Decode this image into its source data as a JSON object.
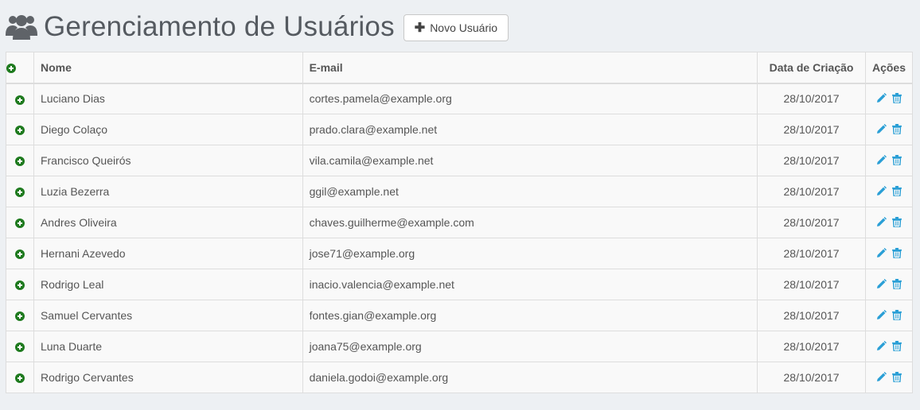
{
  "header": {
    "title": "Gerenciamento de Usuários",
    "new_button_label": "Novo Usuário",
    "icon": "users-icon"
  },
  "table": {
    "columns": {
      "name": "Nome",
      "email": "E-mail",
      "created": "Data de Criação",
      "actions": "Ações"
    },
    "rows": [
      {
        "name": "Luciano Dias",
        "email": "cortes.pamela@example.org",
        "created": "28/10/2017"
      },
      {
        "name": "Diego Colaço",
        "email": "prado.clara@example.net",
        "created": "28/10/2017"
      },
      {
        "name": "Francisco Queirós",
        "email": "vila.camila@example.net",
        "created": "28/10/2017"
      },
      {
        "name": "Luzia Bezerra",
        "email": "ggil@example.net",
        "created": "28/10/2017"
      },
      {
        "name": "Andres Oliveira",
        "email": "chaves.guilherme@example.com",
        "created": "28/10/2017"
      },
      {
        "name": "Hernani Azevedo",
        "email": "jose71@example.org",
        "created": "28/10/2017"
      },
      {
        "name": "Rodrigo Leal",
        "email": "inacio.valencia@example.net",
        "created": "28/10/2017"
      },
      {
        "name": "Samuel Cervantes",
        "email": "fontes.gian@example.org",
        "created": "28/10/2017"
      },
      {
        "name": "Luna Duarte",
        "email": "joana75@example.org",
        "created": "28/10/2017"
      },
      {
        "name": "Rodrigo Cervantes",
        "email": "daniela.godoi@example.org",
        "created": "28/10/2017"
      }
    ]
  },
  "colors": {
    "expand_icon": "#1e7a1e",
    "action_icon": "#2a9fd6",
    "title": "#555a60"
  }
}
